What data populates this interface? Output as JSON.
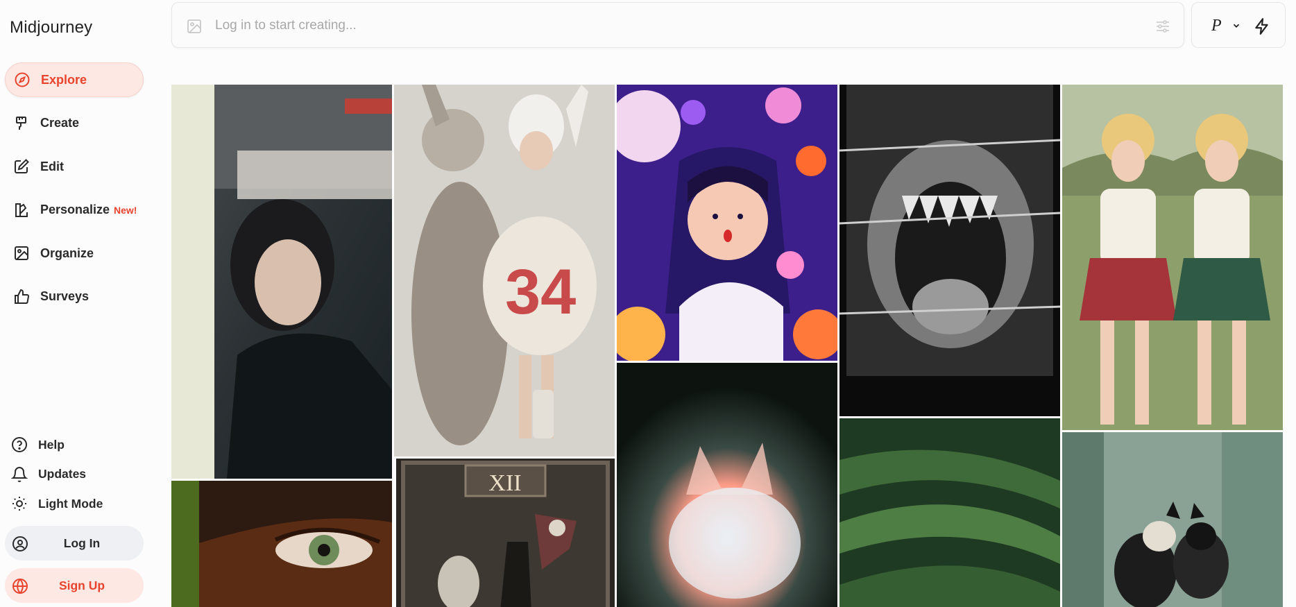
{
  "app": {
    "title": "Midjourney"
  },
  "sidebar": {
    "items": [
      {
        "label": "Explore",
        "icon": "compass-icon",
        "active": true
      },
      {
        "label": "Create",
        "icon": "brush-icon"
      },
      {
        "label": "Edit",
        "icon": "edit-icon"
      },
      {
        "label": "Personalize",
        "icon": "personalize-icon",
        "badge": "New!"
      },
      {
        "label": "Organize",
        "icon": "image-icon"
      },
      {
        "label": "Surveys",
        "icon": "thumbs-up-icon"
      }
    ],
    "help": "Help",
    "updates": "Updates",
    "light_mode": "Light Mode",
    "login": "Log In",
    "signup": "Sign Up"
  },
  "prompt": {
    "placeholder": "Log in to start creating..."
  },
  "mode": {
    "letter": "P"
  },
  "colors": {
    "accent": "#e8432d",
    "accent_bg": "#fde8e4",
    "neutral_pill": "#eef0f3"
  },
  "gallery": [
    {
      "name": "gallery-tile-film-portrait-woman",
      "caption": ""
    },
    {
      "name": "gallery-tile-robot-rabbit-girl",
      "caption": ""
    },
    {
      "name": "gallery-tile-cartoon-girl-purple",
      "caption": ""
    },
    {
      "name": "gallery-tile-mouth-barbed-wire",
      "caption": ""
    },
    {
      "name": "gallery-tile-pinup-golf-girls",
      "caption": ""
    },
    {
      "name": "gallery-tile-eye-closeup",
      "caption": ""
    },
    {
      "name": "gallery-tile-tarot-card-xii",
      "caption": "XII"
    },
    {
      "name": "gallery-tile-glowing-fox",
      "caption": ""
    },
    {
      "name": "gallery-tile-green-dunes",
      "caption": ""
    },
    {
      "name": "gallery-tile-cats-doorway",
      "caption": ""
    }
  ]
}
